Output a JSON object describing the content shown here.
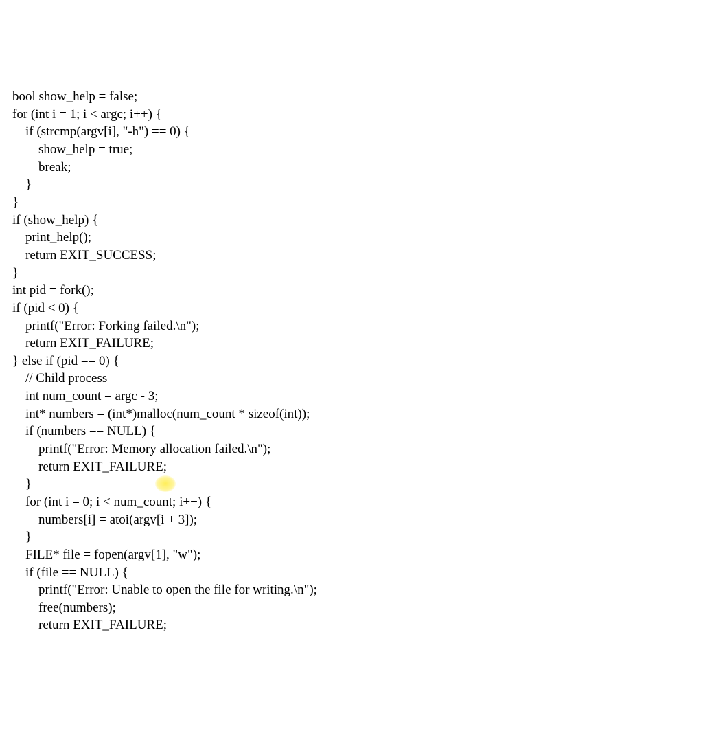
{
  "code": {
    "l01": "bool show_help = false;",
    "l02": "for (int i = 1; i < argc; i++) {",
    "l03": "    if (strcmp(argv[i], \"-h\") == 0) {",
    "l04": "        show_help = true;",
    "l05": "        break;",
    "l06": "    }",
    "l07": "}",
    "l08": "if (show_help) {",
    "l09": "    print_help();",
    "l10": "    return EXIT_SUCCESS;",
    "l11": "}",
    "l12": "int pid = fork();",
    "l13": "if (pid < 0) {",
    "l14": "    printf(\"Error: Forking failed.\\n\");",
    "l15": "    return EXIT_FAILURE;",
    "l16": "} else if (pid == 0) {",
    "l17": "    // Child process",
    "l18": "    int num_count = argc - 3;",
    "l19": "    int* numbers = (int*)malloc(num_count * sizeof(int));",
    "l20": "    if (numbers == NULL) {",
    "l21": "        printf(\"Error: Memory allocation failed.\\n\");",
    "l22": "        return EXIT_FAILURE;",
    "l23": "    }",
    "l24": "    for (int i = 0; i < num_count; i++) {",
    "l25": "        numbers[i] = atoi(argv[i + 3]);",
    "l26": "    }",
    "l27": "    FILE* file = fopen(argv[1], \"w\");",
    "l28": "    if (file == NULL) {",
    "l29": "        printf(\"Error: Unable to open the file for writing.\\n\");",
    "l30": "        free(numbers);",
    "l31": "        return EXIT_FAILURE;"
  }
}
